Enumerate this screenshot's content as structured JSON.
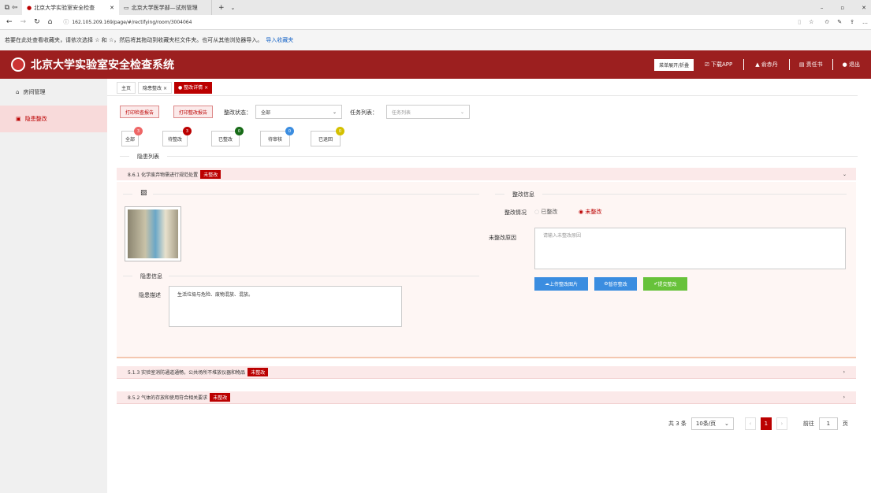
{
  "browser": {
    "tab1_title": "北京大学实验室安全检查",
    "tab2_title": "北京大学医学部—试剂管理",
    "url": "162.105.209.169/page/#/rectifying/room/3004064",
    "fav_hint": "若要在此处查看收藏夹，请依次选择 ☆ 和 ☆，然后将其拖动到收藏夹栏文件夹。也可从其他浏览器导入。",
    "fav_link": "导入收藏夹"
  },
  "header": {
    "app_title": "北京大学实验室安全检查系统",
    "btn_menu": "菜单展开/折叠",
    "btn_download": "下载APP",
    "user_name": "俞赤丹",
    "btn_responsibility": "责任书",
    "btn_logout": "退出"
  },
  "sidebar": {
    "items": [
      {
        "label": "房间管理"
      },
      {
        "label": "隐患整改"
      }
    ]
  },
  "breadcrumb": {
    "home": "主页",
    "tab1": "隐患整改",
    "tab2": "整改详情"
  },
  "toolbar": {
    "print_check": "打印检查报告",
    "print_rectify": "打印整改报告",
    "status_label": "整改状态：",
    "status_value": "全部",
    "task_label": "任务列表：",
    "task_placeholder": "任务列表"
  },
  "filters": [
    {
      "label": "全部",
      "count": "3",
      "color": "#e66"
    },
    {
      "label": "待整改",
      "count": "3",
      "color": "#b00"
    },
    {
      "label": "已整改",
      "count": "0",
      "color": "#176b17"
    },
    {
      "label": "待审核",
      "count": "0",
      "color": "#3b8de0"
    },
    {
      "label": "已退回",
      "count": "0",
      "color": "#d4c000"
    }
  ],
  "hazard_list_title": "隐患列表",
  "hazards": [
    {
      "title": "8.6.1 化学废弃物需进行规范处置",
      "status": "未整改"
    },
    {
      "title": "5.1.3 实验室消防通道通畅，公共场所不堆放仪器和物品",
      "status": "未整改"
    },
    {
      "title": "8.5.2 气体的存放和使用符合相关要求",
      "status": "未整改"
    }
  ],
  "detail": {
    "hazard_info_title": "隐患信息",
    "hazard_desc_label": "隐患描述",
    "hazard_desc_value": "生活垃圾与危险、废物混放、混放。",
    "rectify_info_title": "整改信息",
    "rectify_status_label": "整改情况",
    "option_done": "已整改",
    "option_undone": "未整改",
    "reason_label": "未整改原因",
    "reason_placeholder": "请输入未整改原因",
    "btn_upload": "上传整改图片",
    "btn_save": "暂存整改",
    "btn_submit": "提交整改"
  },
  "pagination": {
    "total": "共 3 条",
    "page_size": "10条/页",
    "current": "1",
    "goto_label": "前往",
    "goto_value": "1",
    "page_unit": "页"
  }
}
